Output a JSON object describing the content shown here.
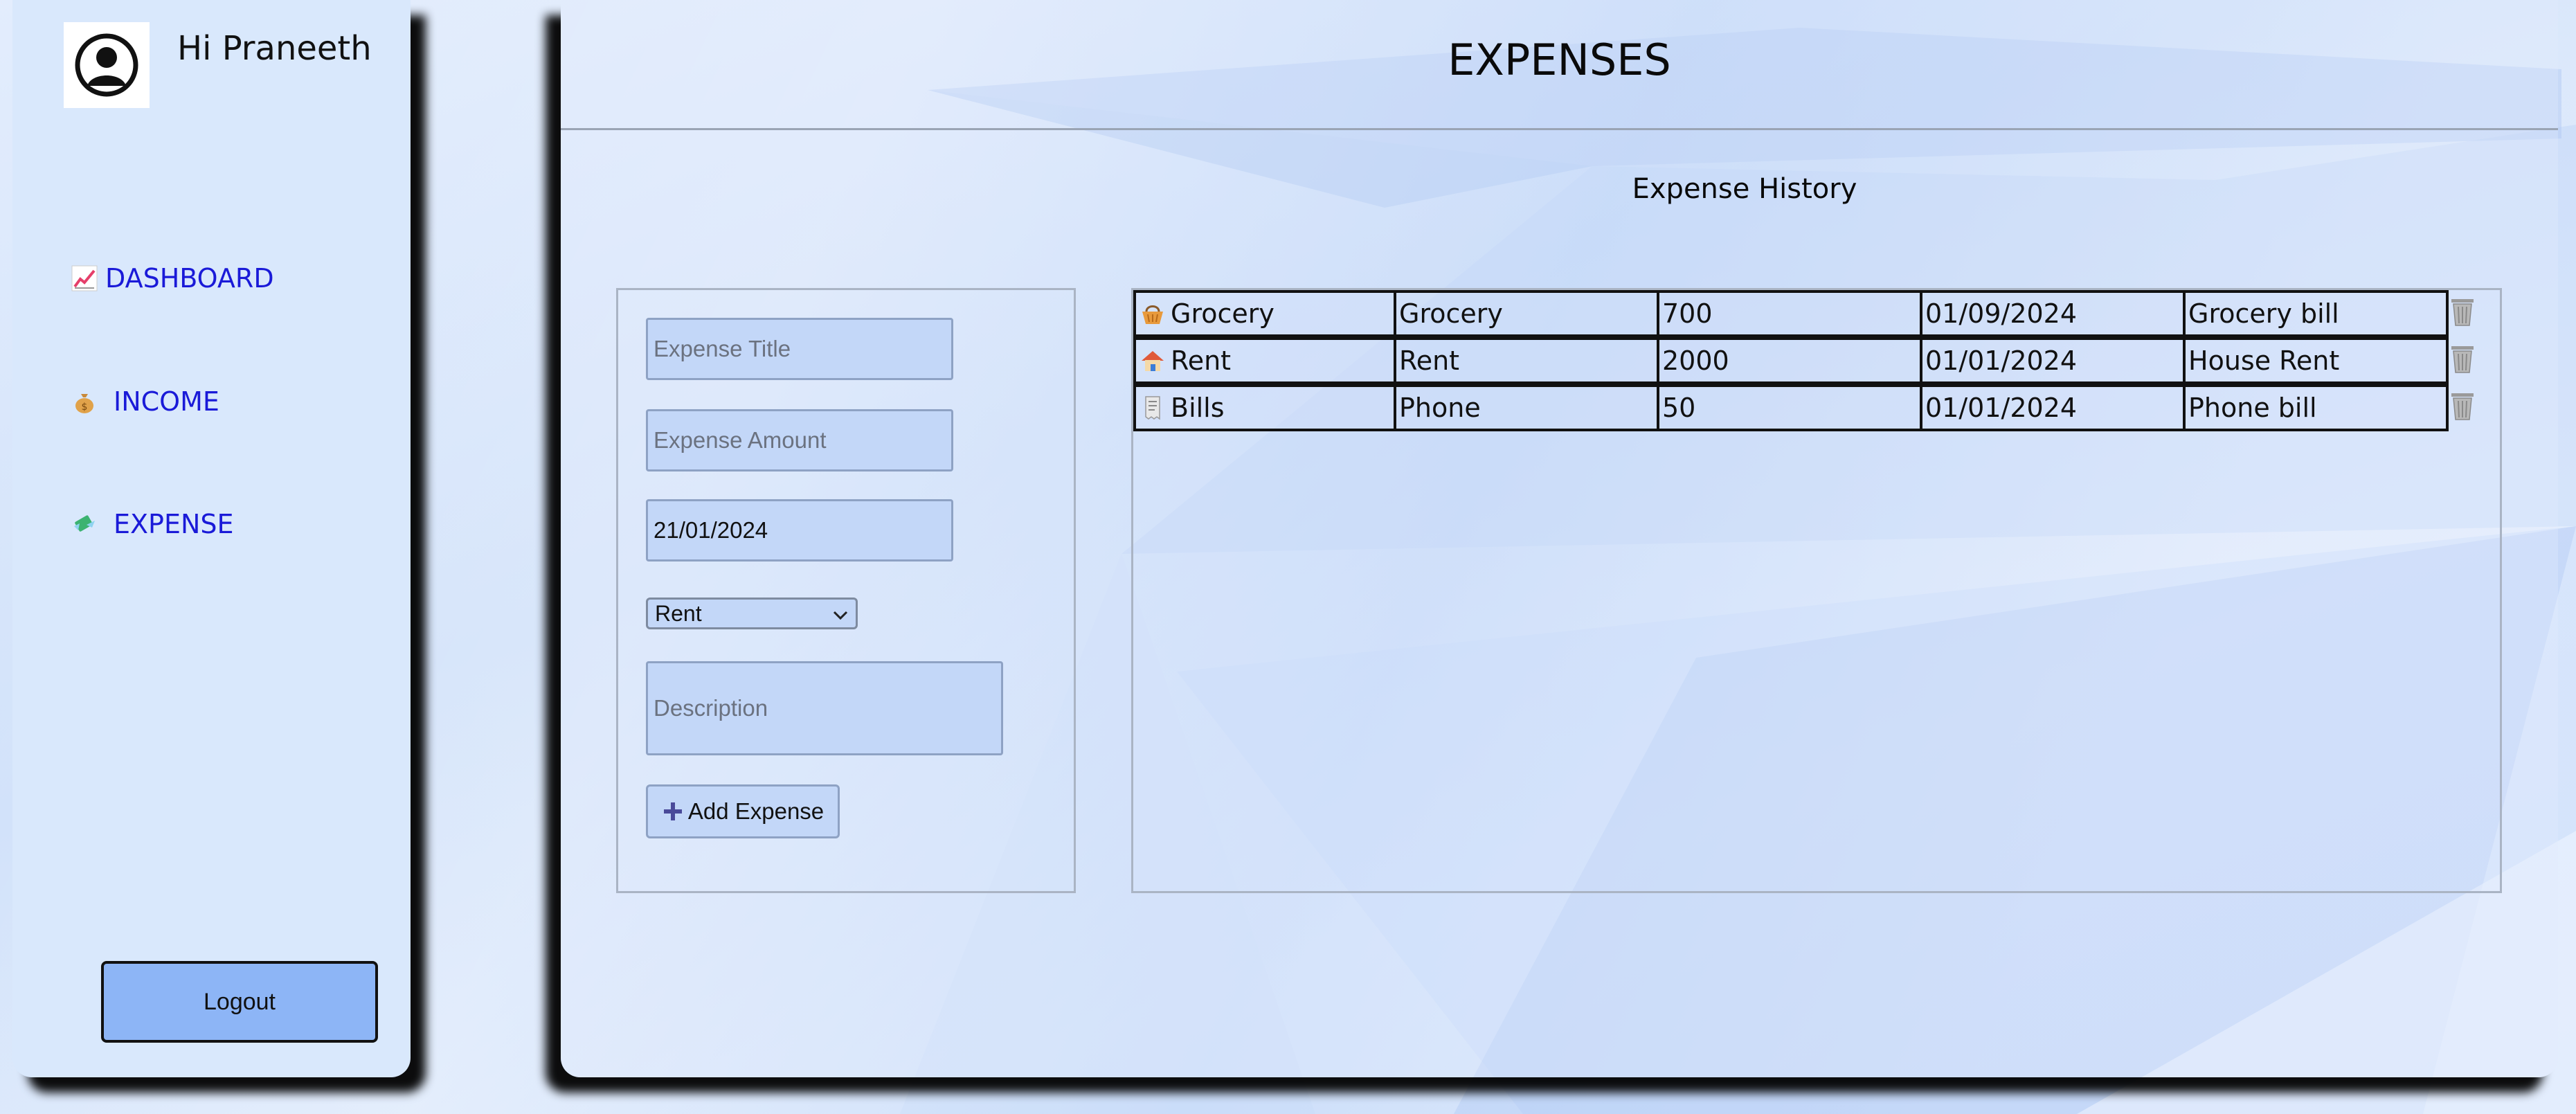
{
  "sidebar": {
    "greeting": "Hi Praneeth",
    "nav": [
      {
        "label": "DASHBOARD",
        "icon": "chart-increasing-icon"
      },
      {
        "label": "INCOME",
        "icon": "money-bag-icon"
      },
      {
        "label": "EXPENSE",
        "icon": "money-with-wings-icon"
      }
    ],
    "logout_label": "Logout"
  },
  "main": {
    "title": "EXPENSES",
    "history_title": "Expense History"
  },
  "form": {
    "title_placeholder": "Expense Title",
    "amount_placeholder": "Expense Amount",
    "date_value": "21/01/2024",
    "category_selected": "Rent",
    "description_placeholder": "Description",
    "add_label": "Add Expense"
  },
  "expenses": [
    {
      "icon": "shopping-basket-icon",
      "title": "Grocery",
      "category": "Grocery",
      "amount": "700",
      "date": "01/09/2024",
      "description": "Grocery bill"
    },
    {
      "icon": "house-icon",
      "title": "Rent",
      "category": "Rent",
      "amount": "2000",
      "date": "01/01/2024",
      "description": "House Rent"
    },
    {
      "icon": "receipt-icon",
      "title": "Bills",
      "category": "Phone",
      "amount": "50",
      "date": "01/01/2024",
      "description": "Phone bill"
    }
  ],
  "colors": {
    "nav_link": "#1a1ad8",
    "logout_bg": "#8db5f6",
    "field_bg": "#c3d7f8"
  }
}
